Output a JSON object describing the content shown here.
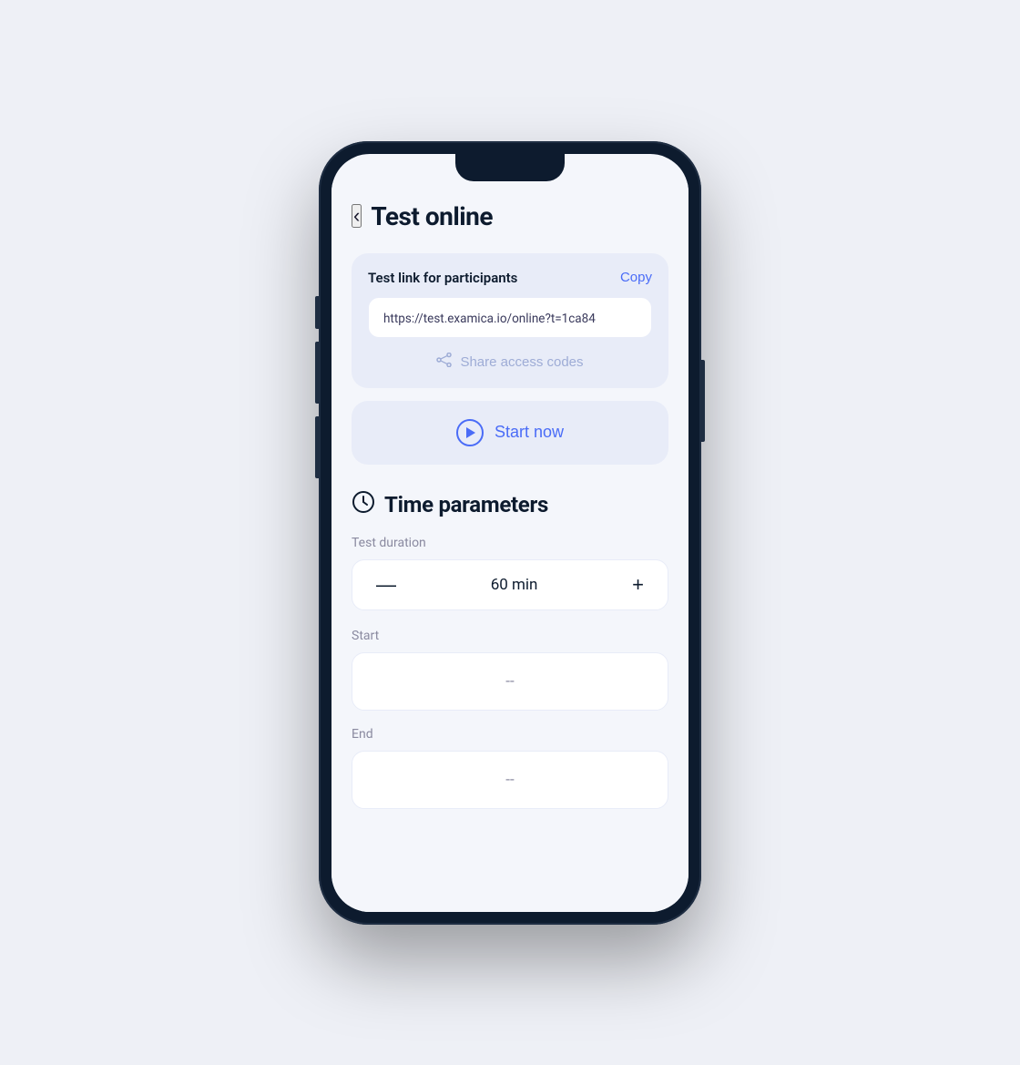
{
  "page": {
    "title": "Test online",
    "back_label": "‹"
  },
  "test_link_card": {
    "title": "Test link for participants",
    "copy_label": "Copy",
    "link_url": "https://test.examica.io/online?t=1ca84",
    "share_access_label": "Share access codes"
  },
  "start_now": {
    "label": "Start now"
  },
  "time_parameters": {
    "section_title": "Time parameters",
    "duration_label": "Test duration",
    "duration_value": "60 min",
    "start_label": "Start",
    "start_placeholder": "--",
    "end_label": "End",
    "end_placeholder": "--"
  },
  "icons": {
    "back": "‹",
    "clock": "⊙",
    "share": "⇝",
    "minus": "—",
    "plus": "+"
  }
}
